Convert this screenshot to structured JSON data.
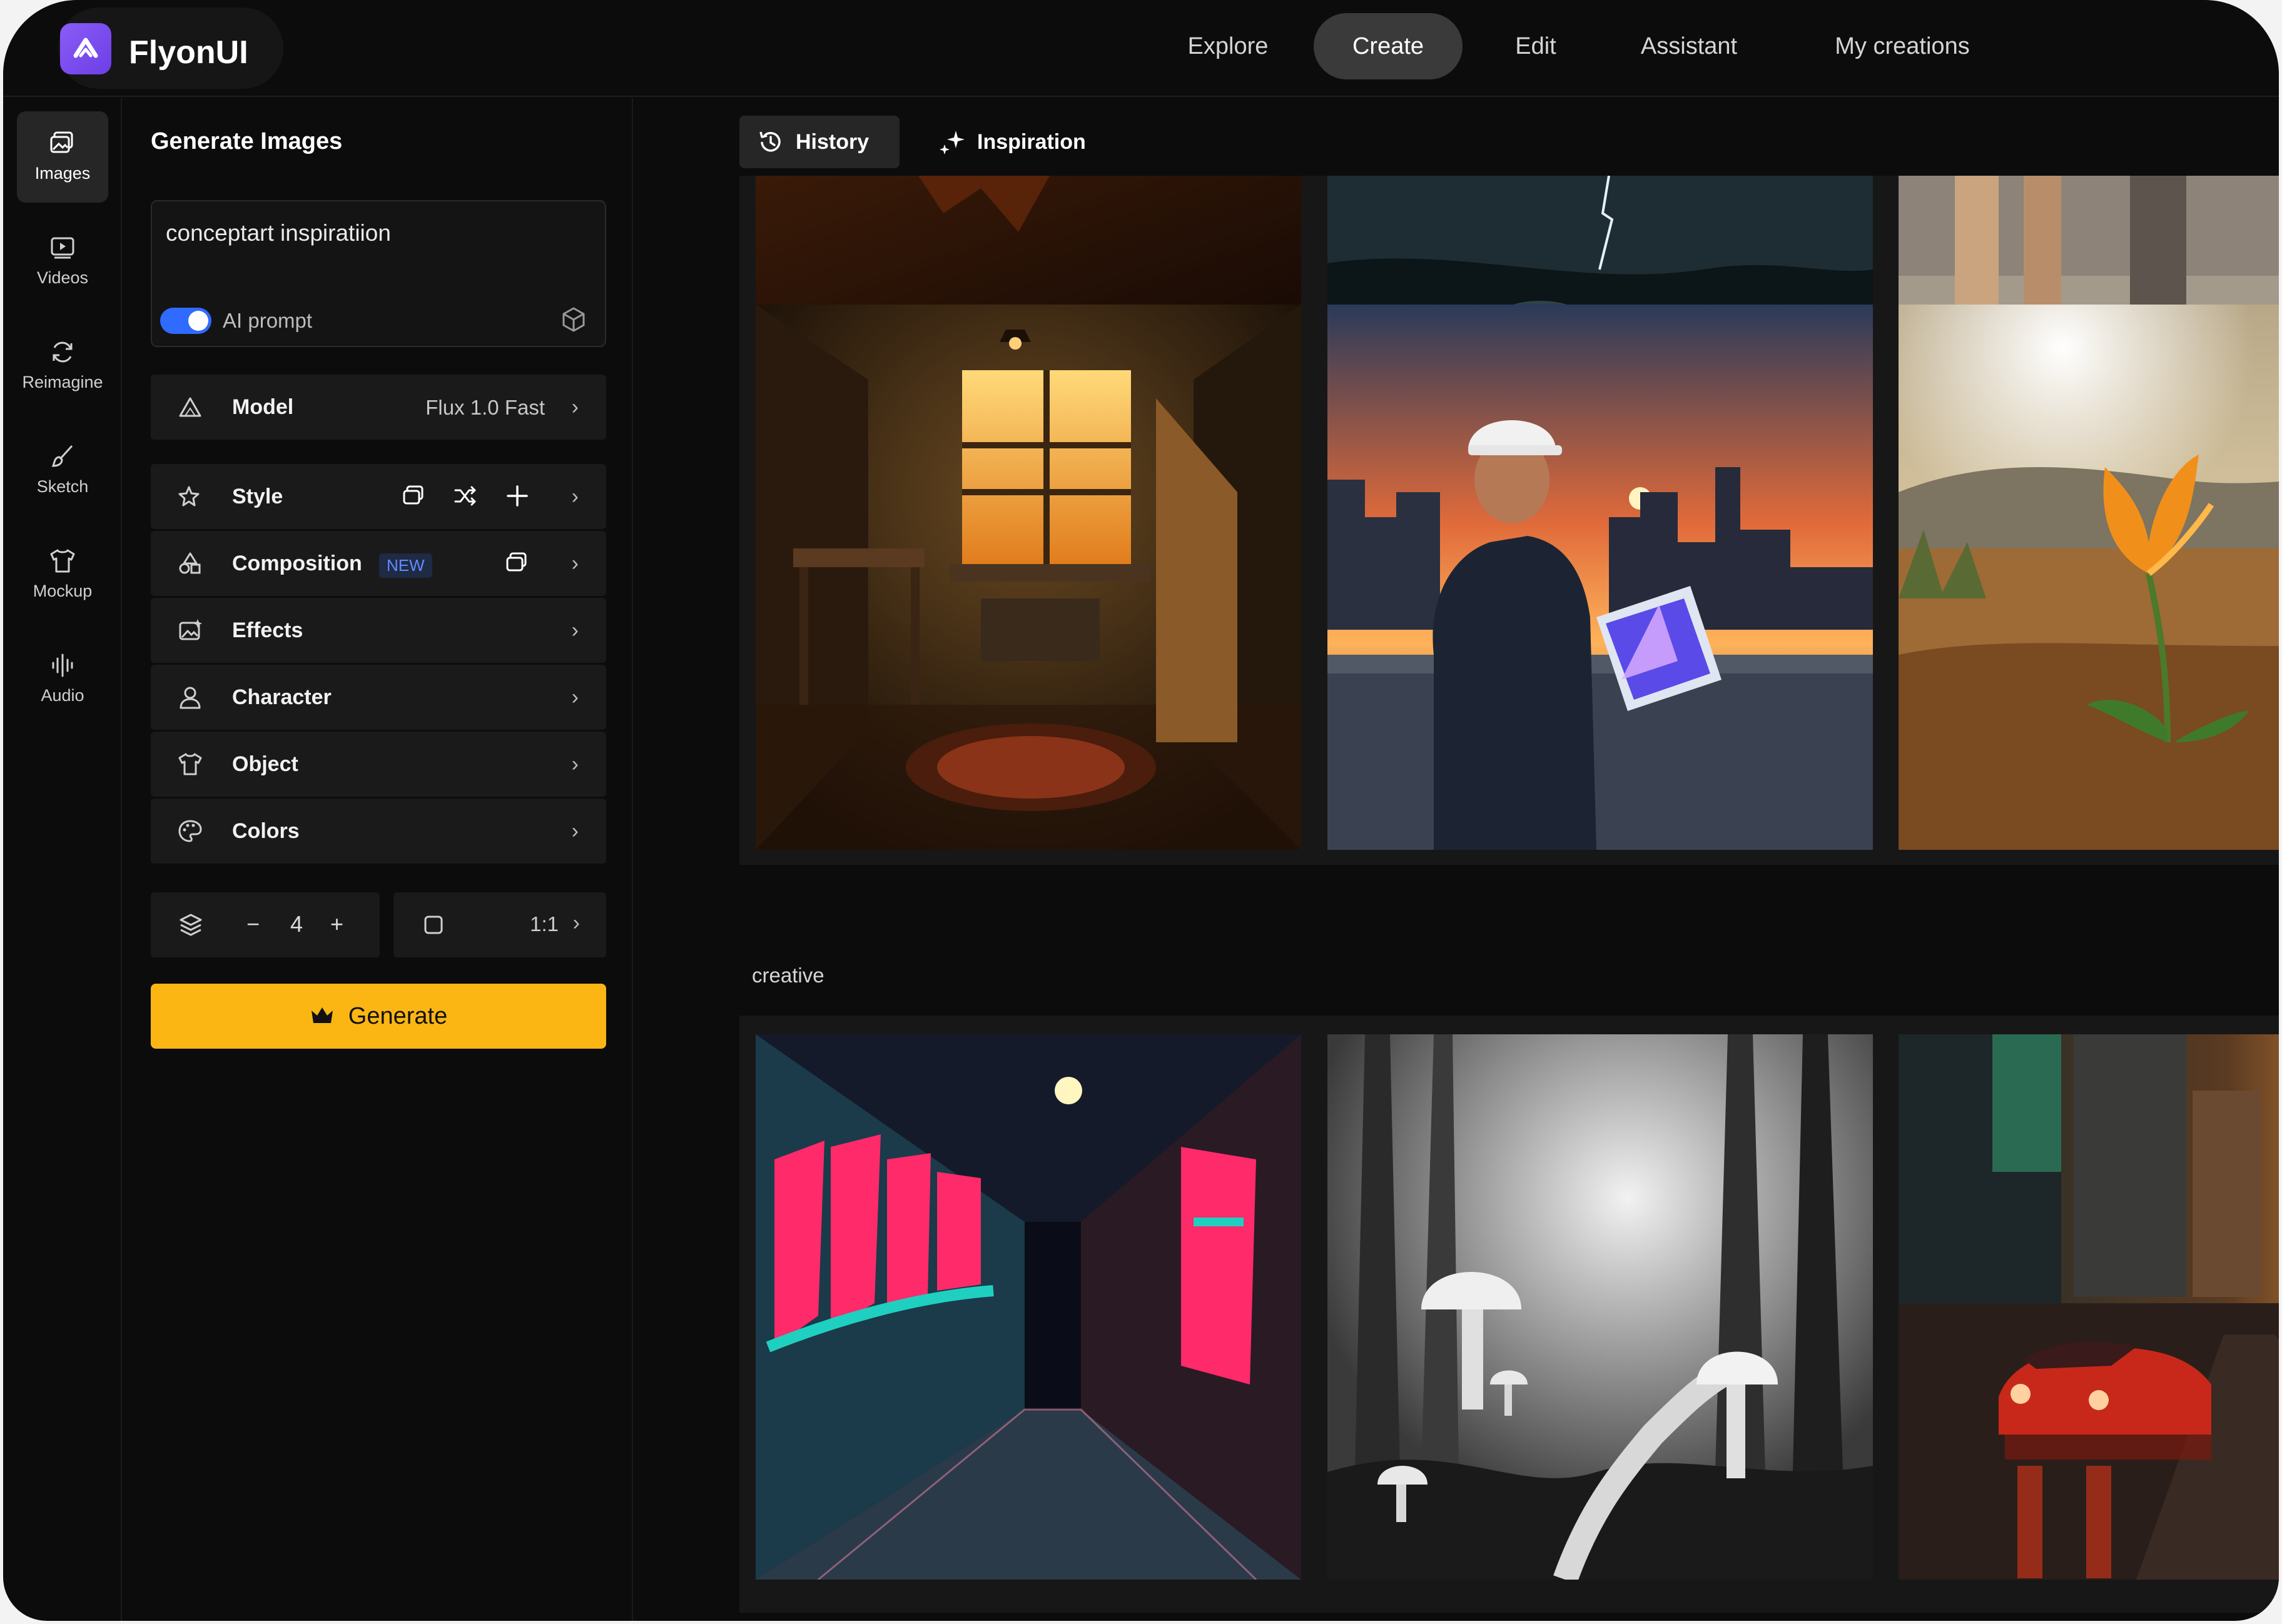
{
  "brand": {
    "name": "FlyonUI"
  },
  "nav": {
    "items": [
      "Explore",
      "Create",
      "Edit",
      "Assistant",
      "My creations"
    ],
    "active": "Create"
  },
  "rail": {
    "items": [
      "Images",
      "Videos",
      "Reimagine",
      "Sketch",
      "Mockup",
      "Audio"
    ],
    "active": "Images"
  },
  "panel": {
    "title": "Generate Images",
    "prompt": {
      "value": "conceptart  inspiratiion",
      "ai_prompt_label": "AI prompt",
      "ai_prompt_on": true
    },
    "model": {
      "label": "Model",
      "value": "Flux 1.0 Fast"
    },
    "options": [
      "Style",
      "Composition",
      "Effects",
      "Character",
      "Object",
      "Colors"
    ],
    "composition_badge": "NEW",
    "count": {
      "value": "4",
      "minus": "−",
      "plus": "+"
    },
    "ratio": "1:1",
    "generate_label": "Generate"
  },
  "gallery": {
    "tabs": [
      "History",
      "Inspiration"
    ],
    "active_tab": "History",
    "section_label": "creative",
    "images": [
      "dim interior (cropped)",
      "lightning over water (cropped)",
      "people walking on street (cropped)",
      "painter's studio with window",
      "man holding tablet at sunset over city",
      "orange flower in desert",
      "graffiti alley at night",
      "monochrome mushroom forest",
      "red sports car on wet city street"
    ]
  },
  "colors": {
    "accent": "#fbb614",
    "toggle": "#2f6bff",
    "brand": "#7c4dff",
    "bg": "#0c0c0c"
  }
}
